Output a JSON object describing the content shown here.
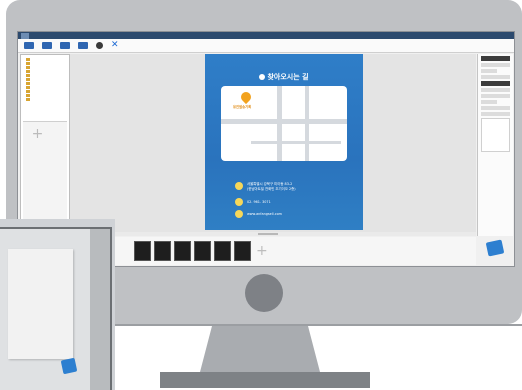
{
  "app": {
    "menus": [
      "",
      "",
      "",
      ""
    ],
    "toolbar": [
      {
        "label": "",
        "icon": "new-document-icon"
      },
      {
        "label": "",
        "icon": "folder-icon"
      },
      {
        "label": "",
        "icon": "save-icon"
      },
      {
        "label": "",
        "icon": "export-icon"
      },
      {
        "label": "",
        "icon": "print-icon"
      },
      {
        "label": "",
        "icon": "close-icon"
      }
    ],
    "left_panel": {
      "title": "",
      "tree": [
        "",
        "",
        "",
        "",
        "",
        "",
        "",
        "",
        "",
        "",
        ""
      ]
    },
    "poster": {
      "title": "찾아오시는 길",
      "map_labels": {
        "place": "유진발송기획",
        "a": "",
        "b": "",
        "c": "",
        "d": "",
        "e": "",
        "f": ""
      },
      "info_title": "",
      "address_line1": "서울특별시 강북구 미아동 83-2",
      "address_line2": "(한남아트빌 천화빈 초기이오 2층)",
      "phone": "02. 961. 3071",
      "website": "www.anfangsell.com"
    },
    "right_panel": {
      "labels": [
        "",
        "",
        ""
      ]
    },
    "finish_button": {
      "label": ""
    }
  },
  "colors": {
    "poster_blue": "#2f7ec8",
    "accent_orange": "#f2a21d",
    "titlebar": "#2c4a6e"
  }
}
